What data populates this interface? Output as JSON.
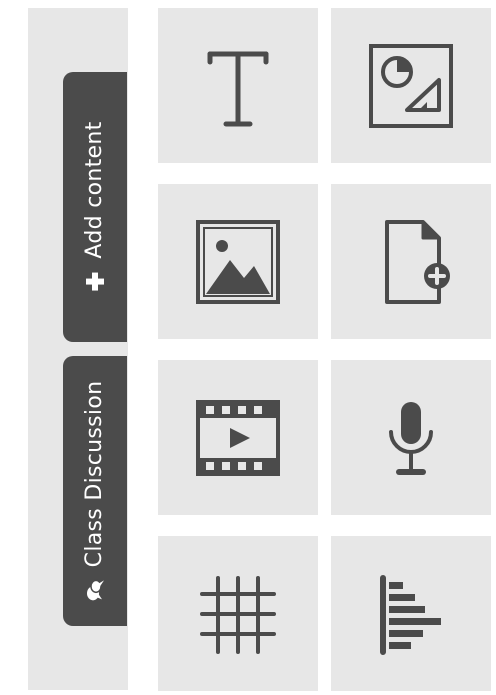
{
  "sidebar": {
    "add_content_label": "Add content",
    "class_discussion_label": "Class Discussion"
  },
  "tiles": [
    {
      "name": "text-tile",
      "icon": "text-icon"
    },
    {
      "name": "shapes-tile",
      "icon": "shapes-icon"
    },
    {
      "name": "image-tile",
      "icon": "image-icon"
    },
    {
      "name": "add-file-tile",
      "icon": "file-add-icon"
    },
    {
      "name": "video-tile",
      "icon": "video-icon"
    },
    {
      "name": "audio-tile",
      "icon": "microphone-icon"
    },
    {
      "name": "table-tile",
      "icon": "grid-icon"
    },
    {
      "name": "chart-tile",
      "icon": "bar-chart-icon"
    }
  ],
  "colors": {
    "panel": "#e7e7e7",
    "tab": "#4b4b4b",
    "icon": "#4b4b4b",
    "text_on_tab": "#ffffff"
  }
}
